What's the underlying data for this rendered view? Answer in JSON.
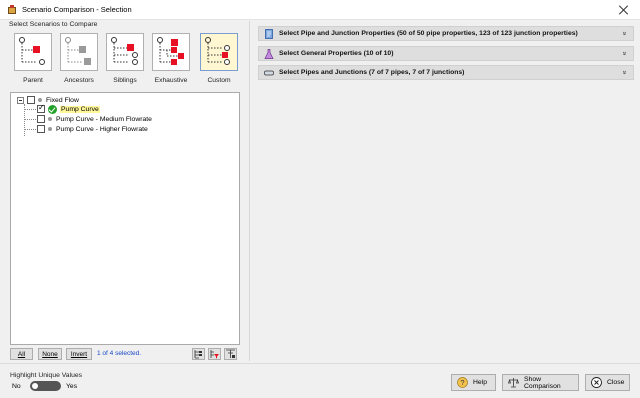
{
  "window": {
    "title": "Scenario Comparison - Selection",
    "icon": "app-icon"
  },
  "left": {
    "section_label": "Select Scenarios to Compare",
    "scenario_buttons": [
      {
        "label": "Parent",
        "icon": "parent-tree-icon"
      },
      {
        "label": "Ancestors",
        "icon": "ancestors-tree-icon"
      },
      {
        "label": "Siblings",
        "icon": "siblings-tree-icon"
      },
      {
        "label": "Exhaustive",
        "icon": "exhaustive-tree-icon"
      },
      {
        "label": "Custom",
        "icon": "custom-tree-icon",
        "selected": true
      }
    ],
    "tree": [
      {
        "label": "Fixed Flow",
        "level": 0,
        "checked": false,
        "expanded": true
      },
      {
        "label": "Pump Curve",
        "level": 1,
        "checked": true,
        "current": true
      },
      {
        "label": "Pump Curve - Medium Flowrate",
        "level": 1,
        "checked": false
      },
      {
        "label": "Pump Curve - Higher Flowrate",
        "level": 1,
        "checked": false
      }
    ],
    "buttons": {
      "all": "All",
      "none": "None",
      "invert": "Invert"
    },
    "selection_count": "1 of 4 selected."
  },
  "right": {
    "sections": [
      {
        "label": "Select Pipe and Junction Properties (50 of 50  pipe properties, 123 of 123 junction properties)",
        "icon": "properties-book-icon"
      },
      {
        "label": "Select General Properties (10 of 10)",
        "icon": "flask-icon"
      },
      {
        "label": "Select Pipes and Junctions (7 of 7  pipes, 7 of 7 junctions)",
        "icon": "pipe-icon"
      }
    ],
    "chevron": "»"
  },
  "footer": {
    "highlight_label": "Highlight Unique Values",
    "toggle_no": "No",
    "toggle_yes": "Yes",
    "toggle_on": false,
    "help": "Help",
    "show_comparison": "Show Comparison",
    "close": "Close"
  },
  "colors": {
    "accent_red": "#e81123",
    "selection_blue": "#1a49c8",
    "highlight_yellow": "#fff79a",
    "check_green": "#22a02a"
  }
}
